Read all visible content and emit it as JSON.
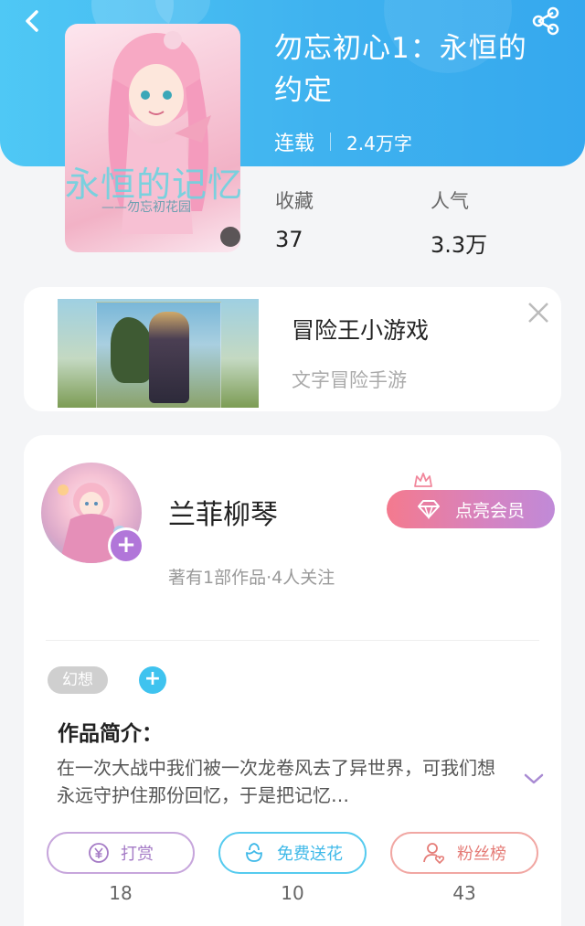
{
  "header": {
    "back_icon": "chevron-left-icon",
    "share_icon": "share-icon"
  },
  "book": {
    "cover_title": "永恒的记忆",
    "cover_subtitle": "——勿忘初花园",
    "title": "勿忘初心1：永恒的约定",
    "status": "连载",
    "word_count": "2.4万字",
    "stats": [
      {
        "label": "收藏",
        "value": "37"
      },
      {
        "label": "人气",
        "value": "3.3万"
      }
    ]
  },
  "ad": {
    "title": "冒险王小游戏",
    "description": "文字冒险手游",
    "close_icon": "close-icon"
  },
  "author": {
    "name": "兰菲柳琴",
    "info": "著有1部作品·4人关注",
    "follow_plus": "+",
    "vip_button": "点亮会员"
  },
  "tags": {
    "items": [
      "幻想"
    ],
    "add": "+"
  },
  "intro": {
    "title": "作品简介：",
    "text": "在一次大战中我们被一次龙卷风去了异世界，可我们想永远守护住那份回忆，于是把记忆…"
  },
  "actions": [
    {
      "label": "打赏",
      "icon": "coin-icon",
      "count": "18",
      "color": "#a57bc6"
    },
    {
      "label": "免费送花",
      "icon": "flower-icon",
      "count": "10",
      "color": "#3fb9e8"
    },
    {
      "label": "粉丝榜",
      "icon": "fans-ranking-icon",
      "count": "43",
      "color": "#e57c77"
    }
  ]
}
